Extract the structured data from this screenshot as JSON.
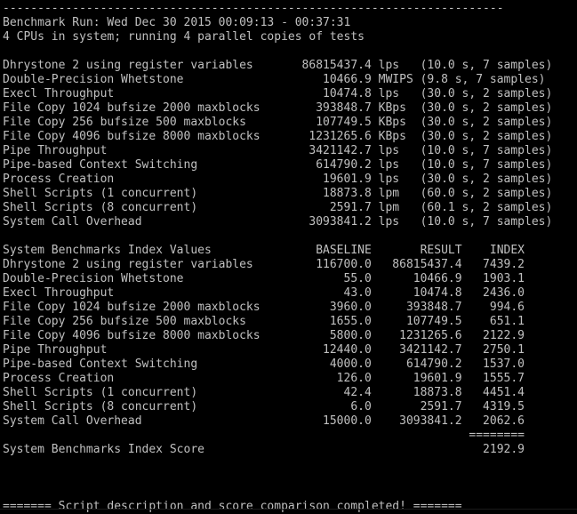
{
  "terminal": {
    "lines": [
      "------------------------------------------------------------------------",
      "Benchmark Run: Wed Dec 30 2015 00:09:13 - 00:37:31",
      "4 CPUs in system; running 4 parallel copies of tests",
      "",
      "Dhrystone 2 using register variables       86815437.4 lps   (10.0 s, 7 samples)",
      "Double-Precision Whetstone                    10466.9 MWIPS (9.8 s, 7 samples)",
      "Execl Throughput                              10474.8 lps   (30.0 s, 2 samples)",
      "File Copy 1024 bufsize 2000 maxblocks        393848.7 KBps  (30.0 s, 2 samples)",
      "File Copy 256 bufsize 500 maxblocks          107749.5 KBps  (30.0 s, 2 samples)",
      "File Copy 4096 bufsize 8000 maxblocks       1231265.6 KBps  (30.0 s, 2 samples)",
      "Pipe Throughput                             3421142.7 lps   (10.0 s, 7 samples)",
      "Pipe-based Context Switching                 614790.2 lps   (10.0 s, 7 samples)",
      "Process Creation                              19601.9 lps   (30.0 s, 2 samples)",
      "Shell Scripts (1 concurrent)                  18873.8 lpm   (60.0 s, 2 samples)",
      "Shell Scripts (8 concurrent)                   2591.7 lpm   (60.1 s, 2 samples)",
      "System Call Overhead                        3093841.2 lps   (10.0 s, 7 samples)",
      "",
      "System Benchmarks Index Values               BASELINE       RESULT    INDEX",
      "Dhrystone 2 using register variables         116700.0   86815437.4   7439.2",
      "Double-Precision Whetstone                       55.0      10466.9   1903.1",
      "Execl Throughput                                 43.0      10474.8   2436.0",
      "File Copy 1024 bufsize 2000 maxblocks          3960.0     393848.7    994.6",
      "File Copy 256 bufsize 500 maxblocks            1655.0     107749.5    651.1",
      "File Copy 4096 bufsize 8000 maxblocks          5800.0    1231265.6   2122.9",
      "Pipe Throughput                               12440.0    3421142.7   2750.1",
      "Pipe-based Context Switching                   4000.0     614790.2   1537.0",
      "Process Creation                                126.0      19601.9   1555.7",
      "Shell Scripts (1 concurrent)                     42.4      18873.8   4451.4",
      "Shell Scripts (8 concurrent)                      6.0       2591.7   4319.5",
      "System Call Overhead                          15000.0    3093841.2   2062.6",
      "                                                                   ========",
      "System Benchmarks Index Score                                        2192.9",
      "",
      "",
      "",
      "======= Script description and score comparison completed! ======="
    ]
  },
  "colors": {
    "background": "#000000",
    "foreground": "#c0c0c0"
  }
}
